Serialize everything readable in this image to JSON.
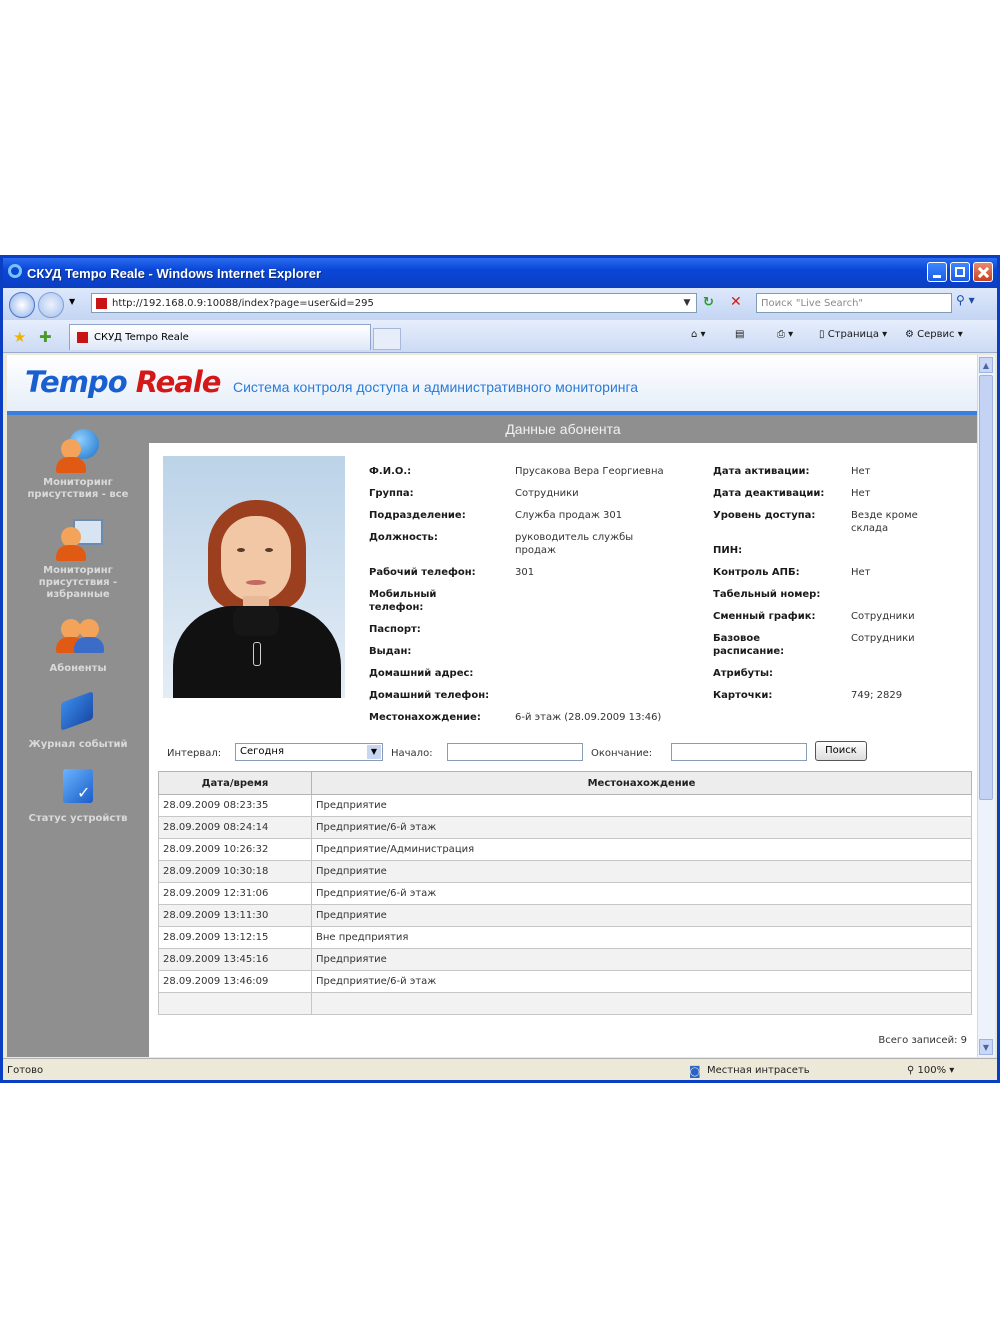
{
  "window": {
    "title": "СКУД Tempo Reale - Windows Internet Explorer"
  },
  "browser": {
    "url": "http://192.168.0.9:10088/index?page=user&id=295",
    "search_placeholder": "Поиск \"Live Search\"",
    "tab_title": "СКУД Tempo Reale",
    "page_menu": "Страница",
    "tools_menu": "Сервис",
    "status_text": "Готово",
    "zone": "Местная интрасеть",
    "zoom": "100%"
  },
  "header": {
    "logo_part1": "Tempo",
    "logo_part2": "Reale",
    "subtitle": "Система контроля доступа и административного мониторинга"
  },
  "sidebar": {
    "items": [
      {
        "label": "Мониторинг присутствия - все",
        "icon": "globe-user-icon"
      },
      {
        "label": "Мониторинг присутствия - избранные",
        "icon": "monitor-user-icon"
      },
      {
        "label": "Абоненты",
        "icon": "users-icon"
      },
      {
        "label": "Журнал событий",
        "icon": "book-icon"
      },
      {
        "label": "Статус устройств",
        "icon": "device-check-icon"
      }
    ]
  },
  "main": {
    "section_title": "Данные абонента"
  },
  "subscriber": {
    "fio_label": "Ф.И.О.:",
    "fio": "Прусакова Вера Георгиевна",
    "group_label": "Группа:",
    "group": "Сотрудники",
    "dept_label": "Подразделение:",
    "dept": "Служба продаж 301",
    "position_label": "Должность:",
    "position": "руководитель службы продаж",
    "work_phone_label": "Рабочий телефон:",
    "work_phone": "301",
    "mobile_label": "Мобильный телефон:",
    "passport_label": "Паспорт:",
    "issued_label": "Выдан:",
    "home_address_label": "Домашний адрес:",
    "home_phone_label": "Домашний телефон:",
    "location_label": "Местонахождение:",
    "location": "6-й этаж (28.09.2009 13:46)",
    "activation_label": "Дата активации:",
    "activation": "Нет",
    "deactivation_label": "Дата деактивации:",
    "deactivation": "Нет",
    "access_label": "Уровень доступа:",
    "access": "Везде кроме склада",
    "pin_label": "ПИН:",
    "apb_label": "Контроль АПБ:",
    "apb": "Нет",
    "tab_number_label": "Табельный номер:",
    "shift_label": "Сменный график:",
    "shift": "Сотрудники",
    "base_schedule_label": "Базовое расписание:",
    "base_schedule": "Сотрудники",
    "attributes_label": "Атрибуты:",
    "cards_label": "Карточки:",
    "cards": "749; 2829"
  },
  "filter": {
    "interval_label": "Интервал:",
    "interval_value": "Сегодня",
    "start_label": "Начало:",
    "end_label": "Окончание:",
    "search_button": "Поиск"
  },
  "table": {
    "headers": [
      "Дата/время",
      "Местонахождение"
    ],
    "rows": [
      [
        "28.09.2009 08:23:35",
        "Предприятие"
      ],
      [
        "28.09.2009 08:24:14",
        "Предприятие/6-й этаж"
      ],
      [
        "28.09.2009 10:26:32",
        "Предприятие/Администрация"
      ],
      [
        "28.09.2009 10:30:18",
        "Предприятие"
      ],
      [
        "28.09.2009 12:31:06",
        "Предприятие/6-й этаж"
      ],
      [
        "28.09.2009 13:11:30",
        "Предприятие"
      ],
      [
        "28.09.2009 13:12:15",
        "Вне предприятия"
      ],
      [
        "28.09.2009 13:45:16",
        "Предприятие"
      ],
      [
        "28.09.2009 13:46:09",
        "Предприятие/6-й этаж"
      ]
    ],
    "total": "Всего записей: 9"
  },
  "colors": {
    "title_bar": "#0a46d6",
    "logo_blue": "#1a5fd0",
    "logo_red": "#d41818",
    "sidebar": "#8f8f8f"
  }
}
